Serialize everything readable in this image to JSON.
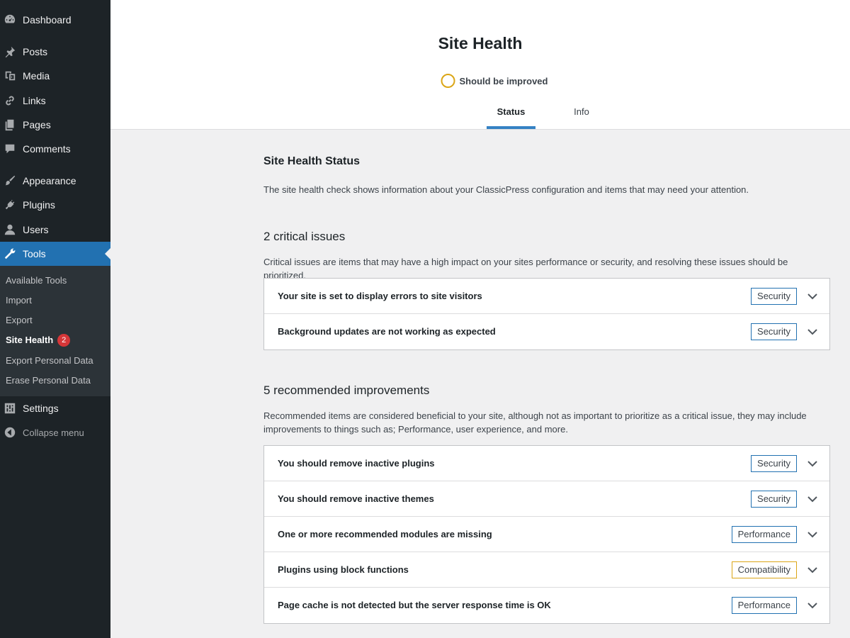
{
  "sidebar": {
    "items": [
      {
        "label": "Dashboard",
        "icon": "dashboard-icon"
      },
      {
        "label": "Posts",
        "icon": "pushpin-icon"
      },
      {
        "label": "Media",
        "icon": "media-icon"
      },
      {
        "label": "Links",
        "icon": "link-icon"
      },
      {
        "label": "Pages",
        "icon": "pages-icon"
      },
      {
        "label": "Comments",
        "icon": "comment-icon"
      },
      {
        "label": "Appearance",
        "icon": "brush-icon"
      },
      {
        "label": "Plugins",
        "icon": "plug-icon"
      },
      {
        "label": "Users",
        "icon": "user-icon"
      },
      {
        "label": "Tools",
        "icon": "wrench-icon"
      },
      {
        "label": "Settings",
        "icon": "settings-icon"
      },
      {
        "label": "Collapse menu",
        "icon": "collapse-icon"
      }
    ],
    "submenu": [
      {
        "label": "Available Tools"
      },
      {
        "label": "Import"
      },
      {
        "label": "Export"
      },
      {
        "label": "Site Health",
        "count": "2"
      },
      {
        "label": "Export Personal Data"
      },
      {
        "label": "Erase Personal Data"
      }
    ]
  },
  "header": {
    "title": "Site Health",
    "status": "Should be improved",
    "tabs": [
      {
        "label": "Status"
      },
      {
        "label": "Info"
      }
    ]
  },
  "main": {
    "section_title": "Site Health Status",
    "intro": "The site health check shows information about your ClassicPress configuration and items that may need your attention.",
    "critical": {
      "heading": "2 critical issues",
      "description": "Critical issues are items that may have a high impact on your sites performance or security, and resolving these issues should be prioritized.",
      "items": [
        {
          "label": "Your site is set to display errors to site visitors",
          "badge": "Security"
        },
        {
          "label": "Background updates are not working as expected",
          "badge": "Security"
        }
      ]
    },
    "recommended": {
      "heading": "5 recommended improvements",
      "description": "Recommended items are considered beneficial to your site, although not as important to prioritize as a critical issue, they may include improvements to things such as; Performance, user experience, and more.",
      "items": [
        {
          "label": "You should remove inactive plugins",
          "badge": "Security"
        },
        {
          "label": "You should remove inactive themes",
          "badge": "Security"
        },
        {
          "label": "One or more recommended modules are missing",
          "badge": "Performance"
        },
        {
          "label": "Plugins using block functions",
          "badge": "Compatibility"
        },
        {
          "label": "Page cache is not detected but the server response time is OK",
          "badge": "Performance"
        }
      ]
    }
  },
  "colors": {
    "sidebar_bg": "#1d2327",
    "accent": "#2271b1",
    "warning": "#dba617",
    "badge_count": "#d63638"
  }
}
